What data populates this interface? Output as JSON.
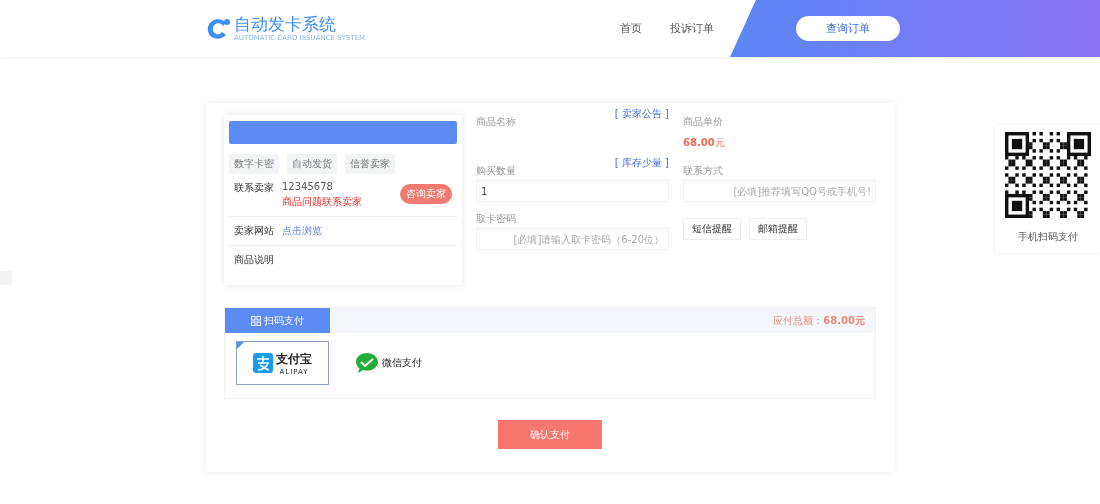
{
  "header": {
    "logo_title": "自动发卡系统",
    "logo_subtitle": "AUTOMATIC CARD ISSUANCE SYSTEM",
    "nav": [
      {
        "label": "首页"
      },
      {
        "label": "投诉订单"
      }
    ],
    "query_button": "查询订单"
  },
  "seller_card": {
    "tags": [
      "数字卡密",
      "自动发货",
      "信誉卖家"
    ],
    "contact_label": "联系卖家",
    "contact_value": "12345678",
    "contact_note": "商品问题联系卖家",
    "consult_button": "咨询卖家",
    "site_label": "卖家网站",
    "site_link": "点击浏览",
    "desc_label": "商品说明"
  },
  "form": {
    "name_label": "商品名称",
    "notice_link": "[ 卖家公告 ]",
    "price_label": "商品单价",
    "price": "68.00",
    "price_unit": "元",
    "qty_label": "购买数量",
    "stock_link": "[ 库存少量 ]",
    "qty_value": "1",
    "contact_label": "联系方式",
    "contact_placeholder": "[必填]推荐填写QQ号或手机号!",
    "pwd_label": "取卡密码",
    "pwd_placeholder": "[必填]请输入取卡密码（6-20位）",
    "reminders": [
      {
        "label": "短信提醒"
      },
      {
        "label": "邮箱提醒"
      }
    ]
  },
  "payment": {
    "tab": "扫码支付",
    "total_label": "应付总额：",
    "total_value": "68.00元",
    "methods": [
      {
        "kind": "alipay",
        "title": "支付宝",
        "subtitle": "ALIPAY",
        "selected": true
      },
      {
        "kind": "wechat",
        "title": "微信支付",
        "selected": false
      }
    ],
    "confirm_button": "确认支付"
  },
  "qr_panel": {
    "caption": "手机扫码支付"
  }
}
